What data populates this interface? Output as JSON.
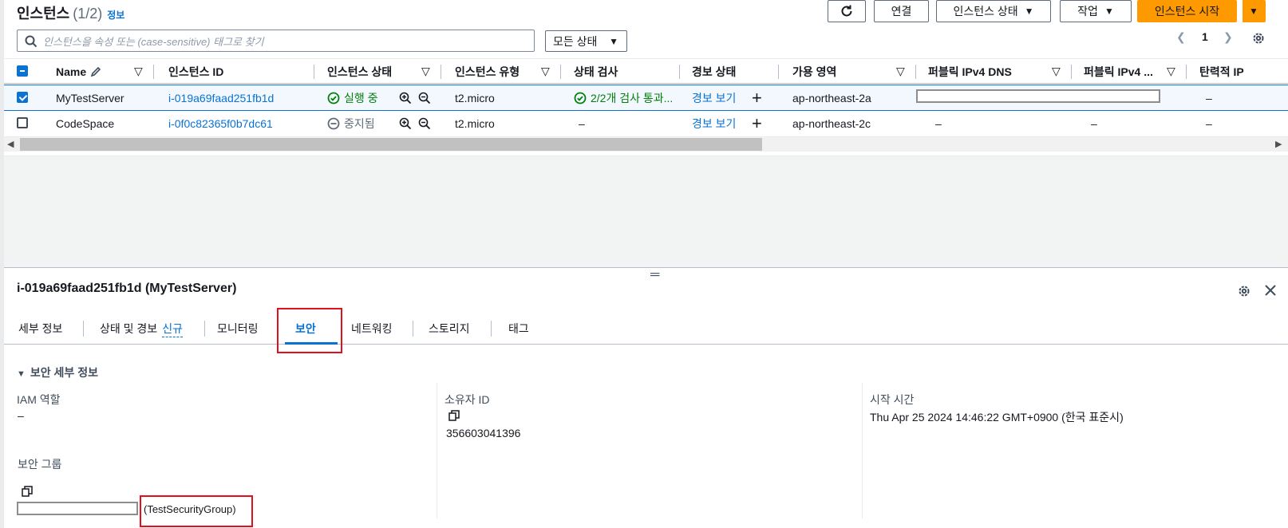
{
  "header": {
    "title": "인스턴스",
    "count": "(1/2)",
    "info_link": "정보",
    "connect_label": "연결",
    "instance_state_label": "인스턴스 상태",
    "actions_label": "작업",
    "launch_label": "인스턴스 시작"
  },
  "search": {
    "placeholder": "인스턴스을 속성 또는 (case-sensitive) 태그로 찾기"
  },
  "filter": {
    "selected": "모든 상태"
  },
  "pagination": {
    "current_page": "1"
  },
  "table": {
    "columns": [
      "Name",
      "인스턴스 ID",
      "인스턴스 상태",
      "인스턴스 유형",
      "상태 검사",
      "경보 상태",
      "가용 영역",
      "퍼블릭 IPv4 DNS",
      "퍼블릭 IPv4 ...",
      "탄력적 IP"
    ],
    "rows": [
      {
        "name": "MyTestServer",
        "instance_id": "i-019a69faad251fb1d",
        "state": "실행 중",
        "type": "t2.micro",
        "status_check": "2/2개 검사 통과...",
        "alarm": "경보 보기",
        "az": "ap-northeast-2a",
        "elastic_ip": "–",
        "selected": true
      },
      {
        "name": "CodeSpace",
        "instance_id": "i-0f0c82365f0b7dc61",
        "state": "중지됨",
        "type": "t2.micro",
        "status_check": "–",
        "alarm": "경보 보기",
        "az": "ap-northeast-2c",
        "public_dns": "–",
        "public_ipv4": "–",
        "elastic_ip": "–",
        "selected": false
      }
    ]
  },
  "details": {
    "title": "i-019a69faad251fb1d (MyTestServer)",
    "tabs": [
      "세부 정보",
      "상태 및 경보",
      "모니터링",
      "보안",
      "네트워킹",
      "스토리지",
      "태그"
    ],
    "new_badge": "신규",
    "active_tab": "보안",
    "section_title": "보안 세부 정보",
    "iam_role_label": "IAM 역할",
    "iam_role_value": "–",
    "owner_id_label": "소유자 ID",
    "owner_id_value": "356603041396",
    "launch_time_label": "시작 시간",
    "launch_time_value": "Thu Apr 25 2024 14:46:22 GMT+0900 (한국 표준시)",
    "security_groups_label": "보안 그룹",
    "security_group_name": "(TestSecurityGroup)"
  },
  "colors": {
    "primary": "#ff9900",
    "link": "#0972d3",
    "success": "#037f0c",
    "highlight_box": "#e0111d"
  }
}
